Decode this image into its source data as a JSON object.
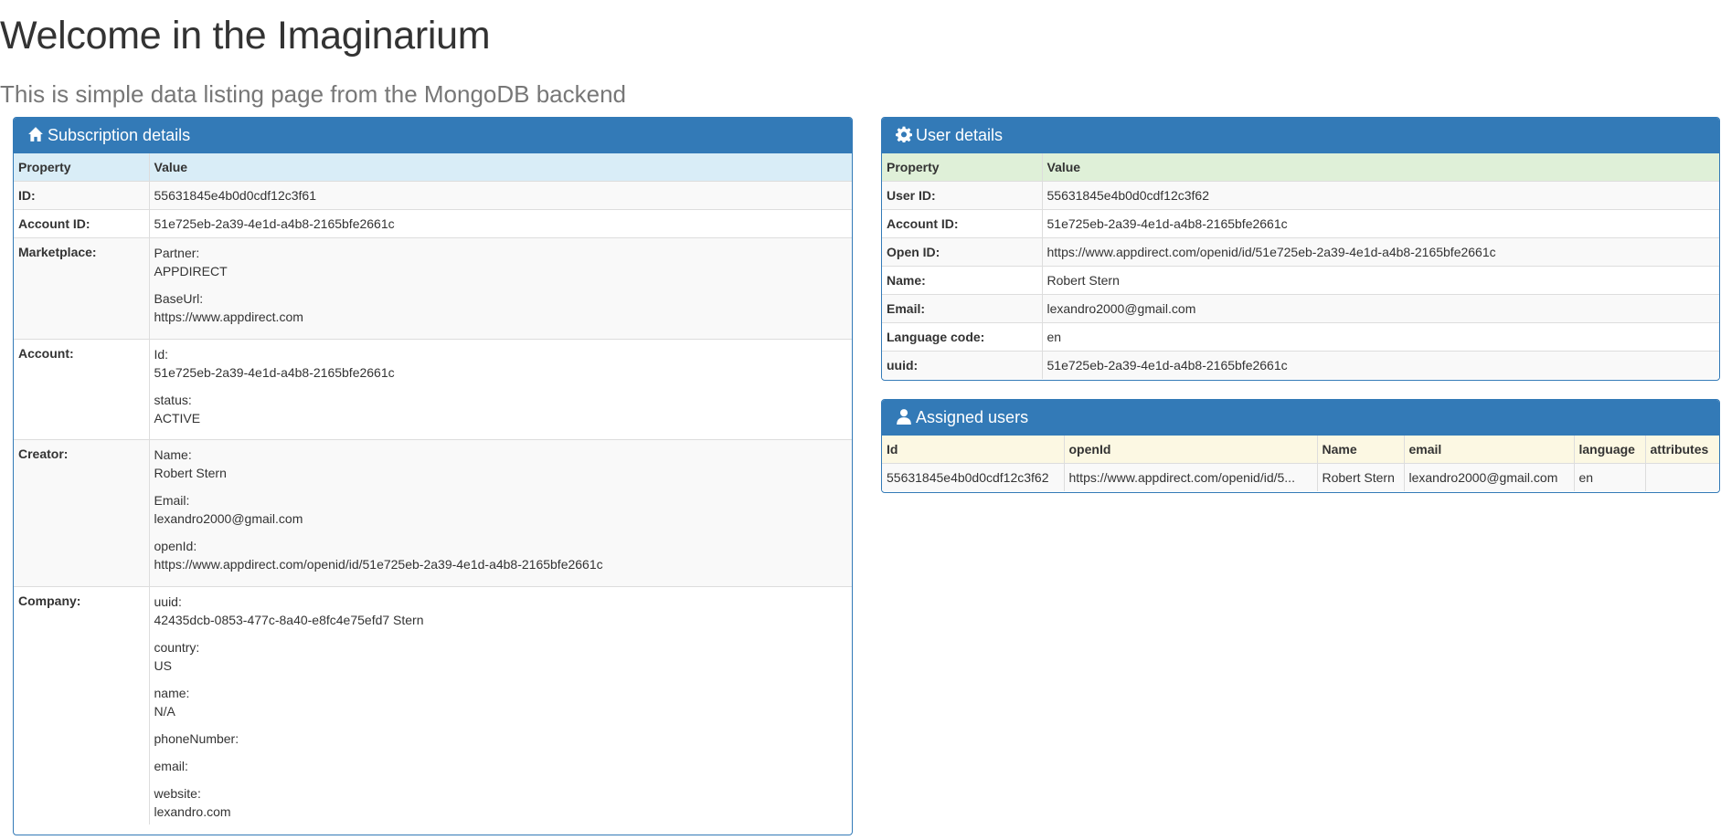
{
  "page": {
    "title": "Welcome in the Imaginarium",
    "subtitle": "This is simple data listing page from the MongoDB backend"
  },
  "subscription": {
    "heading": "Subscription details",
    "icon": "home-icon",
    "columns": [
      "Property",
      "Value"
    ],
    "rows": {
      "id": {
        "label": "ID:",
        "value": "55631845e4b0d0cdf12c3f61"
      },
      "account_id": {
        "label": "Account ID:",
        "value": "51e725eb-2a39-4e1d-a4b8-2165bfe2661c"
      },
      "marketplace": {
        "label": "Marketplace:",
        "partner_key": "Partner:",
        "partner": "APPDIRECT",
        "baseurl_key": "BaseUrl:",
        "baseurl": "https://www.appdirect.com"
      },
      "account": {
        "label": "Account:",
        "id_key": "Id:",
        "id": "51e725eb-2a39-4e1d-a4b8-2165bfe2661c",
        "status_key": "status:",
        "status": "ACTIVE"
      },
      "creator": {
        "label": "Creator:",
        "name_key": "Name:",
        "name": "Robert Stern",
        "email_key": "Email:",
        "email": "lexandro2000@gmail.com",
        "openid_key": "openId:",
        "openid": "https://www.appdirect.com/openid/id/51e725eb-2a39-4e1d-a4b8-2165bfe2661c"
      },
      "company": {
        "label": "Company:",
        "uuid_key": "uuid:",
        "uuid": "42435dcb-0853-477c-8a40-e8fc4e75efd7 Stern",
        "country_key": "country:",
        "country": "US",
        "name_key": "name:",
        "name": "N/A",
        "phone_key": "phoneNumber:",
        "email_key": "email:",
        "website_key": "website:",
        "website": "lexandro.com"
      }
    }
  },
  "user": {
    "heading": "User details",
    "icon": "gear-icon",
    "columns": [
      "Property",
      "Value"
    ],
    "rows": [
      {
        "label": "User ID:",
        "value": "55631845e4b0d0cdf12c3f62"
      },
      {
        "label": "Account ID:",
        "value": "51e725eb-2a39-4e1d-a4b8-2165bfe2661c"
      },
      {
        "label": "Open ID:",
        "value": "https://www.appdirect.com/openid/id/51e725eb-2a39-4e1d-a4b8-2165bfe2661c"
      },
      {
        "label": "Name:",
        "value": "Robert Stern"
      },
      {
        "label": "Email:",
        "value": "lexandro2000@gmail.com"
      },
      {
        "label": "Language code:",
        "value": "en"
      },
      {
        "label": "uuid:",
        "value": "51e725eb-2a39-4e1d-a4b8-2165bfe2661c"
      }
    ]
  },
  "assigned": {
    "heading": "Assigned users",
    "icon": "user-icon",
    "columns": [
      "Id",
      "openId",
      "Name",
      "email",
      "language",
      "attributes"
    ],
    "rows": [
      {
        "id": "55631845e4b0d0cdf12c3f62",
        "openid": "https://www.appdirect.com/openid/id/5...",
        "name": "Robert Stern",
        "email": "lexandro2000@gmail.com",
        "language": "en",
        "attributes": ""
      }
    ]
  },
  "colors": {
    "panel_primary": "#337ab7",
    "header_info": "#d9edf7",
    "header_success": "#dff0d8",
    "header_warning": "#fcf8e3",
    "stripe": "#f9f9f9"
  }
}
